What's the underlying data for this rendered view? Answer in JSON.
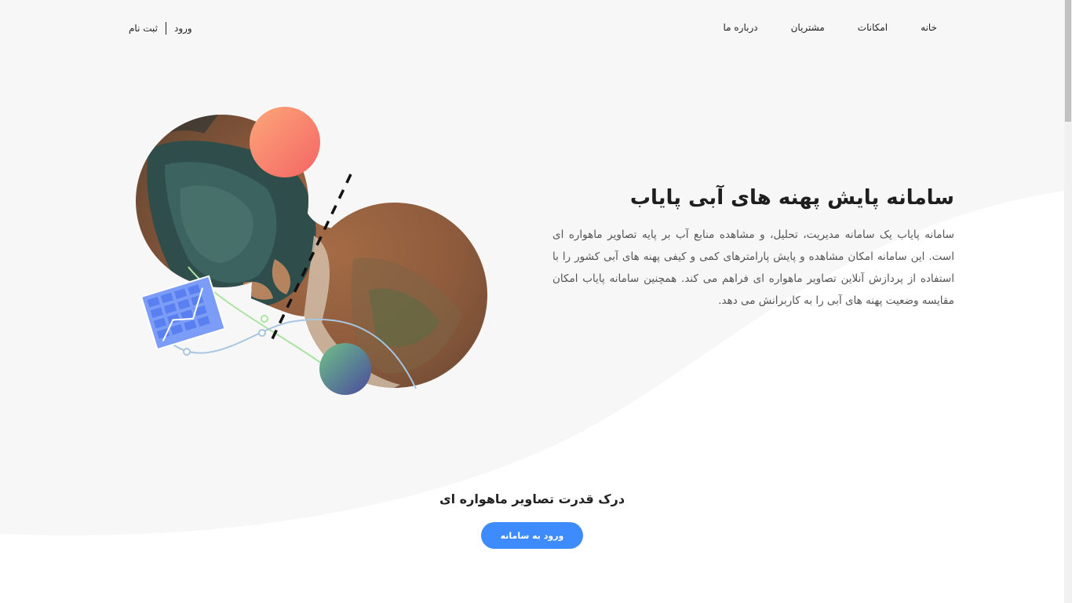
{
  "header": {
    "nav": [
      {
        "label": "خانه"
      },
      {
        "label": "امکانات"
      },
      {
        "label": "مشتریان"
      },
      {
        "label": "درباره ما"
      }
    ],
    "login_label": "ورود",
    "register_label": "ثبت نام"
  },
  "hero": {
    "title": "سامانه پایش پهنه های آبی پایاب",
    "description": "سامانه پایاب یک سامانه مدیریت، تحلیل، و مشاهده منابع آب بر پایه تصاویر ماهواره ای است. این سامانه امکان مشاهده و پایش پارامترهای کمی و کیفی پهنه های آبی کشور را با استفاده از پردازش آنلاین تصاویر ماهواره ای فراهم می کند. همچنین سامانه پایاب امکان مقایسه وضعیت پهنه های آبی را به کاربرانش می دهد."
  },
  "cta": {
    "title": "درک قدرت تصاویر ماهواره ای",
    "button_label": "ورود به سامانه"
  },
  "colors": {
    "accent": "#3d8bfd",
    "background_wave": "#f7f7f7",
    "sun_gradient": [
      "#fca779",
      "#f46565"
    ],
    "globe_gradient": [
      "#6ec188",
      "#4a4a9e"
    ],
    "map_tile": "#7b9cf7"
  }
}
